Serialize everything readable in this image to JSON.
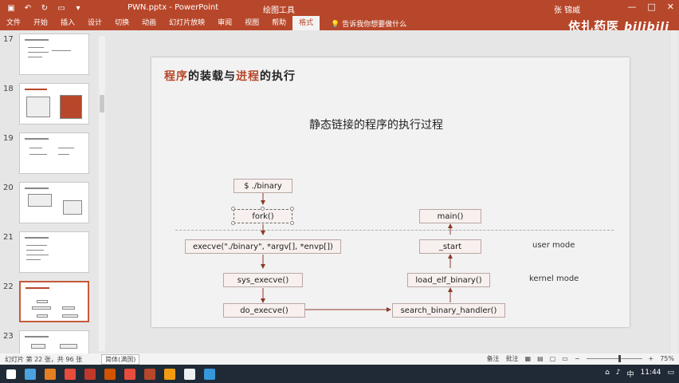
{
  "titlebar": {
    "doc_title": "PWN.pptx - PowerPoint",
    "tools_title": "绘图工具",
    "user": "张 锦威",
    "win_buttons": [
      "—",
      "□",
      "✕"
    ]
  },
  "ribbon": {
    "tabs": [
      "文件",
      "开始",
      "插入",
      "设计",
      "切换",
      "动画",
      "幻灯片放映",
      "审阅",
      "视图",
      "帮助",
      "格式"
    ],
    "active_tab": "格式",
    "tell_me": "告诉我你想要做什么"
  },
  "watermark": {
    "text": "依扎药医",
    "bili": "bilibili"
  },
  "thumbnails": [
    {
      "num": "17",
      "selected": false
    },
    {
      "num": "18",
      "selected": false
    },
    {
      "num": "19",
      "selected": false
    },
    {
      "num": "20",
      "selected": false
    },
    {
      "num": "21",
      "selected": false
    },
    {
      "num": "22",
      "selected": true
    },
    {
      "num": "23",
      "selected": false
    }
  ],
  "slide": {
    "title_parts": [
      "程序",
      "的",
      "装载",
      "与",
      "进程",
      "的执行"
    ],
    "diagram_title": "静态链接的程序的执行过程",
    "nodes": {
      "binary": "$ ./binary",
      "fork": "fork()",
      "execve": "execve(\"./binary\", *argv[], *envp[])",
      "sys_execve": "sys_execve()",
      "do_execve": "do_execve()",
      "search": "search_binary_handler()",
      "load_elf": "load_elf_binary()",
      "start": "_start",
      "main": "main()"
    },
    "user_mode": "user mode",
    "kernel_mode": "kernel mode"
  },
  "statusbar": {
    "slide_info": "幻灯片 第 22 张，共 96 张",
    "notes": "简体(满国)",
    "notes_btn": "备注",
    "comments_btn": "批注",
    "zoom": "75%"
  },
  "taskbar": {
    "clock": "11:44",
    "lang": "中",
    "colors": [
      "#4aa3df",
      "#e67e22",
      "#e74c3c",
      "#c0392b",
      "#d35400",
      "#e74c3c",
      "#b7472a",
      "#f39c12",
      "#ecf0f1",
      "#3498db"
    ]
  }
}
